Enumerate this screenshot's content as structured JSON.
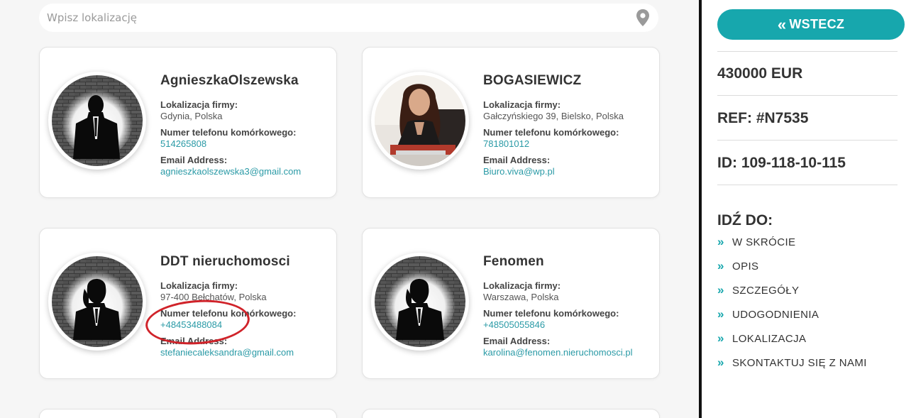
{
  "search": {
    "placeholder": "Wpisz lokalizację",
    "icon": "map-pin-icon"
  },
  "agents": [
    {
      "name": "AgnieszkaOlszewska",
      "avatar": "silhouette-man",
      "location_label": "Lokalizacja firmy:",
      "location": "Gdynia, Polska",
      "phone_label": "Numer telefonu komórkowego:",
      "phone": "514265808",
      "email_label": "Email Address:",
      "email": "agnieszkaolszewska3@gmail.com"
    },
    {
      "name": "BOGASIEWICZ",
      "avatar": "photo-woman",
      "location_label": "Lokalizacja firmy:",
      "location": "Gałczyńskiego 39, Bielsko, Polska",
      "phone_label": "Numer telefonu komórkowego:",
      "phone": "781801012",
      "email_label": "Email Address:",
      "email": "Biuro.viva@wp.pl"
    },
    {
      "name": "DDT nieruchomosci",
      "avatar": "silhouette-woman",
      "location_label": "Lokalizacja firmy:",
      "location": "97-400 Bełchatów, Polska",
      "phone_label": "Numer telefonu komórkowego:",
      "phone": "+48453488084",
      "email_label": "Email Address:",
      "email": "stefaniecaleksandra@gmail.com"
    },
    {
      "name": "Fenomen",
      "avatar": "silhouette-woman",
      "location_label": "Lokalizacja firmy:",
      "location": "Warszawa, Polska",
      "phone_label": "Numer telefonu komórkowego:",
      "phone": "+48505055846",
      "email_label": "Email Address:",
      "email": "karolina@fenomen.nieruchomosci.pl"
    }
  ],
  "sidebar": {
    "back_label": "WSTECZ",
    "back_icon": "double-chevron-left-icon",
    "price": "430000 EUR",
    "ref": "REF: #N7535",
    "id": "ID: 109-118-10-115",
    "goto_title": "IDŹ DO:",
    "nav": [
      {
        "label": "W SKRÓCIE"
      },
      {
        "label": "OPIS"
      },
      {
        "label": "SZCZEGÓŁY"
      },
      {
        "label": "UDOGODNIENIA"
      },
      {
        "label": "LOKALIZACJA"
      },
      {
        "label": "SKONTAKTUJ SIĘ Z NAMI"
      }
    ]
  },
  "colors": {
    "accent": "#17a7ad",
    "link": "#2a9aa6",
    "annotation": "#d0232a"
  }
}
